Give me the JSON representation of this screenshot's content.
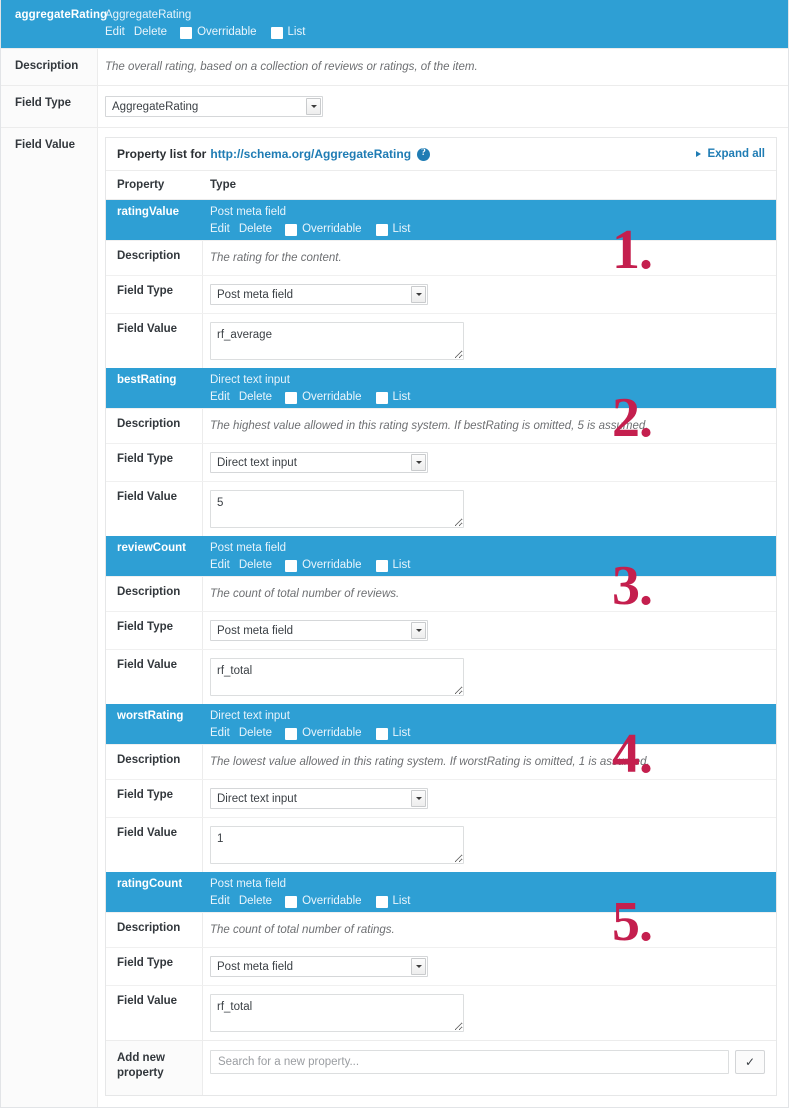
{
  "outer_property": {
    "name": "aggregateRating",
    "type": "AggregateRating",
    "actions": {
      "edit": "Edit",
      "delete": "Delete"
    },
    "checkboxes": {
      "overridable": "Overridable",
      "list": "List"
    },
    "rows": {
      "description_label": "Description",
      "description_text": "The overall rating, based on a collection of reviews or ratings, of the item.",
      "field_type_label": "Field Type",
      "field_type_value": "AggregateRating",
      "field_value_label": "Field Value"
    }
  },
  "panel": {
    "title_prefix": "Property list for",
    "schema_url": "http://schema.org/AggregateRating",
    "help_icon": "help-icon",
    "expand_all": "Expand all",
    "columns": {
      "property": "Property",
      "type": "Type"
    },
    "labels": {
      "description": "Description",
      "field_type": "Field Type",
      "field_value": "Field Value",
      "edit": "Edit",
      "delete": "Delete",
      "overridable": "Overridable",
      "list": "List"
    },
    "properties": [
      {
        "name": "ratingValue",
        "type": "Post meta field",
        "description": "The rating for the content.",
        "field_type": "Post meta field",
        "field_value": "rf_average",
        "annotation": "1."
      },
      {
        "name": "bestRating",
        "type": "Direct text input",
        "description": "The highest value allowed in this rating system. If bestRating is omitted, 5 is assumed.",
        "field_type": "Direct text input",
        "field_value": "5",
        "annotation": "2."
      },
      {
        "name": "reviewCount",
        "type": "Post meta field",
        "description": "The count of total number of reviews.",
        "field_type": "Post meta field",
        "field_value": "rf_total",
        "annotation": "3."
      },
      {
        "name": "worstRating",
        "type": "Direct text input",
        "description": "The lowest value allowed in this rating system. If worstRating is omitted, 1 is assumed.",
        "field_type": "Direct text input",
        "field_value": "1",
        "annotation": "4."
      },
      {
        "name": "ratingCount",
        "type": "Post meta field",
        "description": "The count of total number of ratings.",
        "field_type": "Post meta field",
        "field_value": "rf_total",
        "annotation": "5."
      }
    ],
    "add_new": {
      "label_line1": "Add new",
      "label_line2": "property",
      "placeholder": "Search for a new property...",
      "confirm_icon": "✓"
    }
  },
  "colors": {
    "header_blue": "#2e9fd4",
    "link_blue": "#1f7cb4",
    "annotation_red": "#c41f4e"
  }
}
